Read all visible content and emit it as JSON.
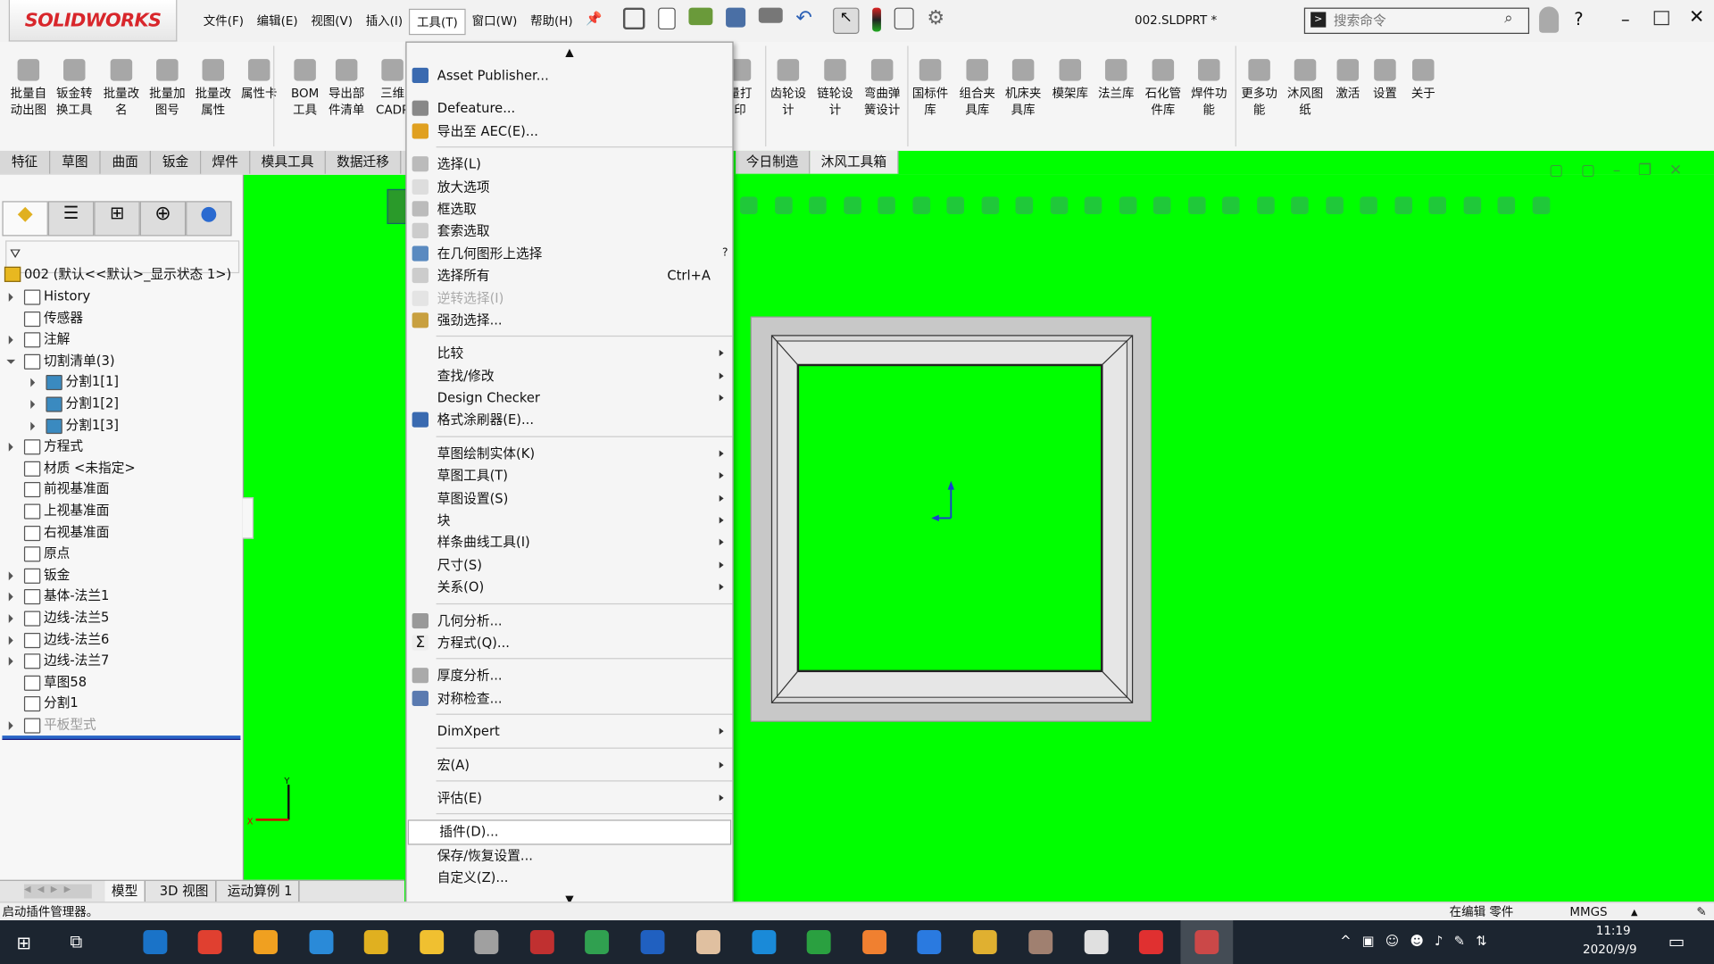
{
  "app": {
    "brand": "SOLIDWORKS",
    "document_title": "002.SLDPRT *",
    "search_placeholder": "搜索命令"
  },
  "menubar": [
    {
      "label": "文件(F)"
    },
    {
      "label": "编辑(E)"
    },
    {
      "label": "视图(V)"
    },
    {
      "label": "插入(I)"
    },
    {
      "label": "工具(T)",
      "active": true
    },
    {
      "label": "窗口(W)"
    },
    {
      "label": "帮助(H)"
    }
  ],
  "ribbon": [
    {
      "l1": "批量自",
      "l2": "动出图"
    },
    {
      "l1": "钣金转",
      "l2": "换工具"
    },
    {
      "l1": "批量改",
      "l2": "名"
    },
    {
      "l1": "批量加",
      "l2": "图号"
    },
    {
      "l1": "批量改",
      "l2": "属性"
    },
    {
      "l1": "属性卡",
      "l2": ""
    },
    {
      "l1": "BOM",
      "l2": "工具"
    },
    {
      "l1": "导出部",
      "l2": "件清单"
    },
    {
      "l1": "三维",
      "l2": "CADP"
    },
    {
      "l1": "量打",
      "l2": "印"
    },
    {
      "l1": "齿轮设",
      "l2": "计"
    },
    {
      "l1": "链轮设",
      "l2": "计"
    },
    {
      "l1": "弯曲弹",
      "l2": "簧设计"
    },
    {
      "l1": "国标件",
      "l2": "库"
    },
    {
      "l1": "组合夹",
      "l2": "具库"
    },
    {
      "l1": "机床夹",
      "l2": "具库"
    },
    {
      "l1": "模架库",
      "l2": ""
    },
    {
      "l1": "法兰库",
      "l2": ""
    },
    {
      "l1": "石化管",
      "l2": "件库"
    },
    {
      "l1": "焊件功",
      "l2": "能"
    },
    {
      "l1": "更多功",
      "l2": "能"
    },
    {
      "l1": "沐风图",
      "l2": "纸"
    },
    {
      "l1": "激活",
      "l2": ""
    },
    {
      "l1": "设置",
      "l2": ""
    },
    {
      "l1": "关于",
      "l2": ""
    }
  ],
  "command_tabs": [
    "特征",
    "草图",
    "曲面",
    "钣金",
    "焊件",
    "模具工具",
    "数据迁移",
    "今日制造",
    "沐风工具箱"
  ],
  "tree": {
    "root": "002  (默认<<默认>_显示状态 1>)",
    "items": [
      {
        "label": "History",
        "level": 0,
        "expand": true
      },
      {
        "label": "传感器",
        "level": 0
      },
      {
        "label": "注解",
        "level": 0,
        "expand": true
      },
      {
        "label": "切割清单(3)",
        "level": 0,
        "expanded": true
      },
      {
        "label": "分割1[1]",
        "level": 1,
        "expand": true
      },
      {
        "label": "分割1[2]",
        "level": 1,
        "expand": true
      },
      {
        "label": "分割1[3]",
        "level": 1,
        "expand": true
      },
      {
        "label": "方程式",
        "level": 0,
        "expand": true
      },
      {
        "label": "材质 <未指定>",
        "level": 0
      },
      {
        "label": "前视基准面",
        "level": 0
      },
      {
        "label": "上视基准面",
        "level": 0
      },
      {
        "label": "右视基准面",
        "level": 0
      },
      {
        "label": "原点",
        "level": 0
      },
      {
        "label": "钣金",
        "level": 0,
        "expand": true
      },
      {
        "label": "基体-法兰1",
        "level": 0,
        "expand": true
      },
      {
        "label": "边线-法兰5",
        "level": 0,
        "expand": true
      },
      {
        "label": "边线-法兰6",
        "level": 0,
        "expand": true
      },
      {
        "label": "边线-法兰7",
        "level": 0,
        "expand": true
      },
      {
        "label": "草图58",
        "level": 0
      },
      {
        "label": "分割1",
        "level": 0
      },
      {
        "label": "平板型式",
        "level": 0,
        "expand": true,
        "disabled": true
      }
    ]
  },
  "tools_menu": [
    {
      "type": "scroll",
      "label": "▲"
    },
    {
      "type": "item",
      "label": "Asset Publisher...",
      "icon": "asset-publisher"
    },
    {
      "type": "pad"
    },
    {
      "type": "item",
      "label": "Defeature...",
      "icon": "defeature"
    },
    {
      "type": "item",
      "label": "导出至 AEC(E)...",
      "icon": "export-aec"
    },
    {
      "type": "sep"
    },
    {
      "type": "item",
      "label": "选择(L)",
      "icon": "select-arrow"
    },
    {
      "type": "item",
      "label": "放大选项",
      "icon": "magnified-select"
    },
    {
      "type": "item",
      "label": "框选取",
      "icon": "box-select"
    },
    {
      "type": "item",
      "label": "套索选取",
      "icon": "lasso-select"
    },
    {
      "type": "item",
      "label": "在几何图形上选择",
      "icon": "select-over-geometry",
      "badge": "?"
    },
    {
      "type": "item",
      "label": "选择所有",
      "icon": "select-all",
      "shortcut": "Ctrl+A"
    },
    {
      "type": "item",
      "label": "逆转选择(I)",
      "icon": "invert-select",
      "disabled": true
    },
    {
      "type": "item",
      "label": "强劲选择...",
      "icon": "power-select"
    },
    {
      "type": "sep"
    },
    {
      "type": "item",
      "label": "比较",
      "submenu": true
    },
    {
      "type": "item",
      "label": "查找/修改",
      "submenu": true
    },
    {
      "type": "item",
      "label": "Design Checker",
      "submenu": true
    },
    {
      "type": "item",
      "label": "格式涂刷器(E)...",
      "icon": "format-painter"
    },
    {
      "type": "sep"
    },
    {
      "type": "item",
      "label": "草图绘制实体(K)",
      "submenu": true
    },
    {
      "type": "item",
      "label": "草图工具(T)",
      "submenu": true
    },
    {
      "type": "item",
      "label": "草图设置(S)",
      "submenu": true
    },
    {
      "type": "item",
      "label": "块",
      "submenu": true
    },
    {
      "type": "item",
      "label": "样条曲线工具(I)",
      "submenu": true
    },
    {
      "type": "item",
      "label": "尺寸(S)",
      "submenu": true
    },
    {
      "type": "item",
      "label": "关系(O)",
      "submenu": true
    },
    {
      "type": "sep"
    },
    {
      "type": "item",
      "label": "几何分析...",
      "icon": "geometry-analysis"
    },
    {
      "type": "item",
      "label": "方程式(Q)...",
      "icon": "sigma"
    },
    {
      "type": "sep"
    },
    {
      "type": "item",
      "label": "厚度分析...",
      "icon": "thickness-analysis"
    },
    {
      "type": "item",
      "label": "对称检查...",
      "icon": "symmetry-check"
    },
    {
      "type": "sep"
    },
    {
      "type": "item",
      "label": "DimXpert",
      "submenu": true
    },
    {
      "type": "sep"
    },
    {
      "type": "item",
      "label": "宏(A)",
      "submenu": true
    },
    {
      "type": "sep"
    },
    {
      "type": "item",
      "label": "评估(E)",
      "submenu": true
    },
    {
      "type": "sep"
    },
    {
      "type": "item",
      "label": "插件(D)...",
      "hover": true
    },
    {
      "type": "item",
      "label": "保存/恢复设置..."
    },
    {
      "type": "item",
      "label": "自定义(Z)..."
    },
    {
      "type": "scroll",
      "label": "▼"
    }
  ],
  "bottom_tabs": [
    "模型",
    "3D 视图",
    "运动算例 1"
  ],
  "status": {
    "message": "启动插件管理器。",
    "mode": "在编辑 零件",
    "units": "MMGS"
  },
  "taskbar": {
    "time": "11:19",
    "date": "2020/9/9"
  },
  "colors": {
    "viewport": "#00ff00",
    "accent": "#d8262b",
    "taskbar": "#1c2530"
  }
}
